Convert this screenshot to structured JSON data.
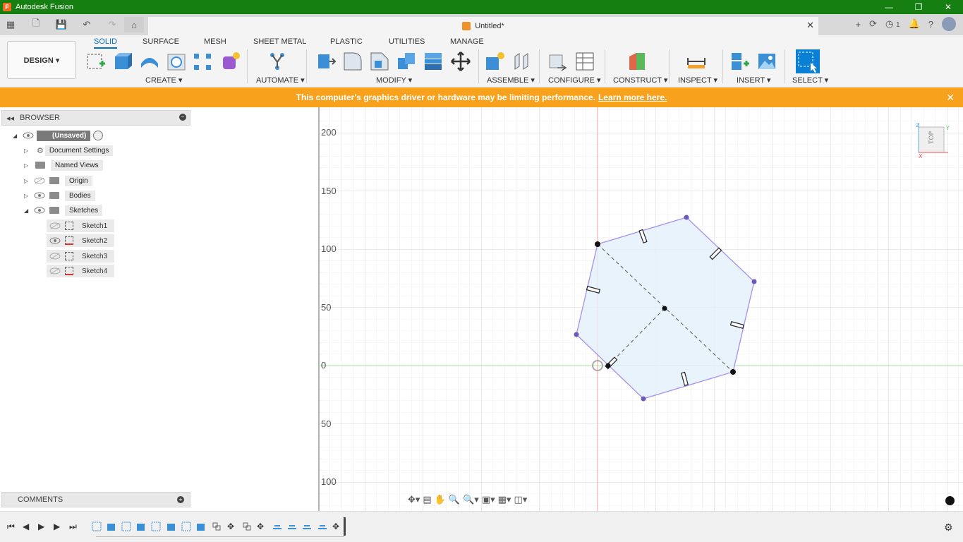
{
  "window": {
    "title": "Autodesk Fusion",
    "minimize": "—",
    "maximize": "❐",
    "close": "✕"
  },
  "doc": {
    "title": "Untitled*",
    "close": "✕",
    "jobs": "1"
  },
  "ribbon": {
    "design_button": "DESIGN ▾",
    "tabs": [
      "SOLID",
      "SURFACE",
      "MESH",
      "SHEET METAL",
      "PLASTIC",
      "UTILITIES",
      "MANAGE"
    ],
    "groups": [
      "CREATE ▾",
      "AUTOMATE ▾",
      "MODIFY ▾",
      "ASSEMBLE ▾",
      "CONFIGURE ▾",
      "CONSTRUCT ▾",
      "INSPECT ▾",
      "INSERT ▾",
      "SELECT ▾"
    ]
  },
  "warning": {
    "text": "This computer's graphics driver or hardware may be limiting performance.",
    "link": "Learn more here.",
    "close": "✕"
  },
  "browser": {
    "title": "BROWSER",
    "root": "(Unsaved)",
    "items": [
      "Document Settings",
      "Named Views",
      "Origin",
      "Bodies",
      "Sketches"
    ],
    "sketches": [
      "Sketch1",
      "Sketch2",
      "Sketch3",
      "Sketch4"
    ]
  },
  "comments": {
    "title": "COMMENTS"
  },
  "axis_labels": [
    "200",
    "150",
    "100",
    "50",
    "0",
    "50",
    "100"
  ],
  "viewcube": {
    "face": "TOP",
    "z": "Z",
    "y": "Y",
    "x": "X"
  },
  "colors": {
    "titlebar": "#157f12",
    "warning": "#f7a11d",
    "accent": "#0a6ebd",
    "sketch_fill": "#e4f0fb",
    "sketch_line": "#a58ff0"
  }
}
